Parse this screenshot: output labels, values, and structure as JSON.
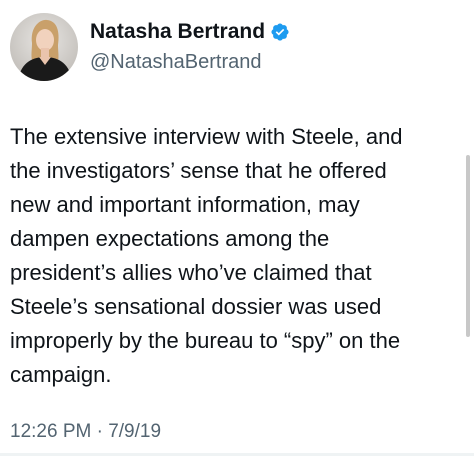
{
  "author": {
    "display_name": "Natasha Bertrand",
    "handle": "@NatashaBertrand",
    "verified": true,
    "verified_color": "#1d9bf0"
  },
  "tweet": {
    "text": "The extensive interview with Steele, and\nthe investigators’ sense that he offered\nnew and important information, may\ndampen expectations among the\npresident’s allies who’ve claimed that\nSteele’s sensational dossier was used\nimproperly by the bureau to “spy” on the\ncampaign.",
    "timestamp": "12:26 PM · 7/9/19"
  }
}
